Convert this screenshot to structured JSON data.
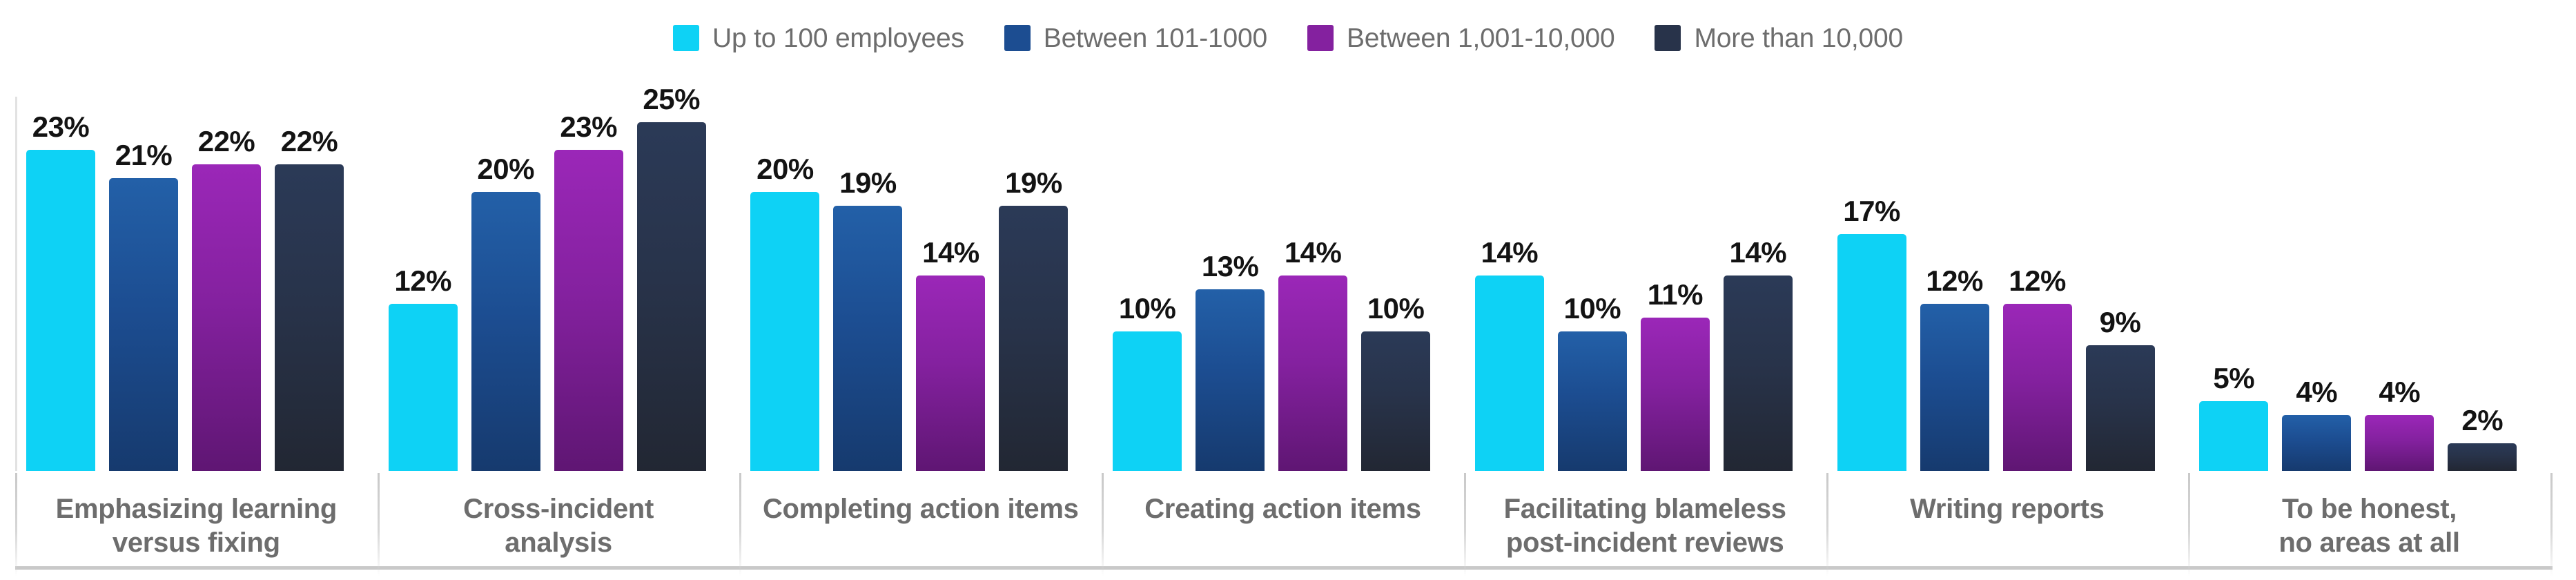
{
  "legend": {
    "items": [
      {
        "label": "Up to 100 employees",
        "color": "#0ed2f5",
        "swatch_name": "legend-swatch-up-to-100"
      },
      {
        "label": "Between 101-1000",
        "color": "#1c4d91",
        "swatch_name": "legend-swatch-101-1000"
      },
      {
        "label": "Between 1,001-10,000",
        "color": "#84219f",
        "swatch_name": "legend-swatch-1001-10000"
      },
      {
        "label": "More than 10,000",
        "color": "#28334a",
        "swatch_name": "legend-swatch-more-than-10000"
      }
    ]
  },
  "chart_data": {
    "type": "bar",
    "title": "",
    "subtitle": "",
    "xlabel": "",
    "ylabel": "",
    "ylim": [
      0,
      26
    ],
    "grid": false,
    "legend_position": "top-center",
    "value_suffix": "%",
    "value_labels_shown": true,
    "categories": [
      "Emphasizing learning versus fixing",
      "Cross-incident analysis",
      "Completing action items",
      "Creating action items",
      "Facilitating blameless post-incident reviews",
      "Writing reports",
      "To be honest, no areas at all"
    ],
    "category_lines": [
      [
        "Emphasizing learning",
        "versus fixing"
      ],
      [
        "Cross-incident",
        "analysis"
      ],
      [
        "Completing action items"
      ],
      [
        "Creating action items"
      ],
      [
        "Facilitating blameless",
        "post-incident reviews"
      ],
      [
        "Writing reports"
      ],
      [
        "To be honest,",
        "no areas at all"
      ]
    ],
    "series": [
      {
        "name": "Up to 100 employees",
        "color": "#0ed2f5",
        "values": [
          23,
          12,
          20,
          10,
          14,
          17,
          5
        ],
        "labels": [
          "23%",
          "12%",
          "20%",
          "10%",
          "14%",
          "17%",
          "5%"
        ]
      },
      {
        "name": "Between 101-1000",
        "color": "#1c4d91",
        "values": [
          21,
          20,
          19,
          13,
          10,
          12,
          4
        ],
        "labels": [
          "21%",
          "20%",
          "19%",
          "13%",
          "10%",
          "12%",
          "4%"
        ]
      },
      {
        "name": "Between 1,001-10,000",
        "color": "#84219f",
        "values": [
          22,
          23,
          14,
          14,
          11,
          12,
          4
        ],
        "labels": [
          "22%",
          "23%",
          "14%",
          "14%",
          "11%",
          "12%",
          "4%"
        ]
      },
      {
        "name": "More than 10,000",
        "color": "#28334a",
        "values": [
          22,
          25,
          19,
          10,
          14,
          9,
          2
        ],
        "labels": [
          "22%",
          "25%",
          "19%",
          "10%",
          "14%",
          "9%",
          "2%"
        ]
      }
    ]
  }
}
